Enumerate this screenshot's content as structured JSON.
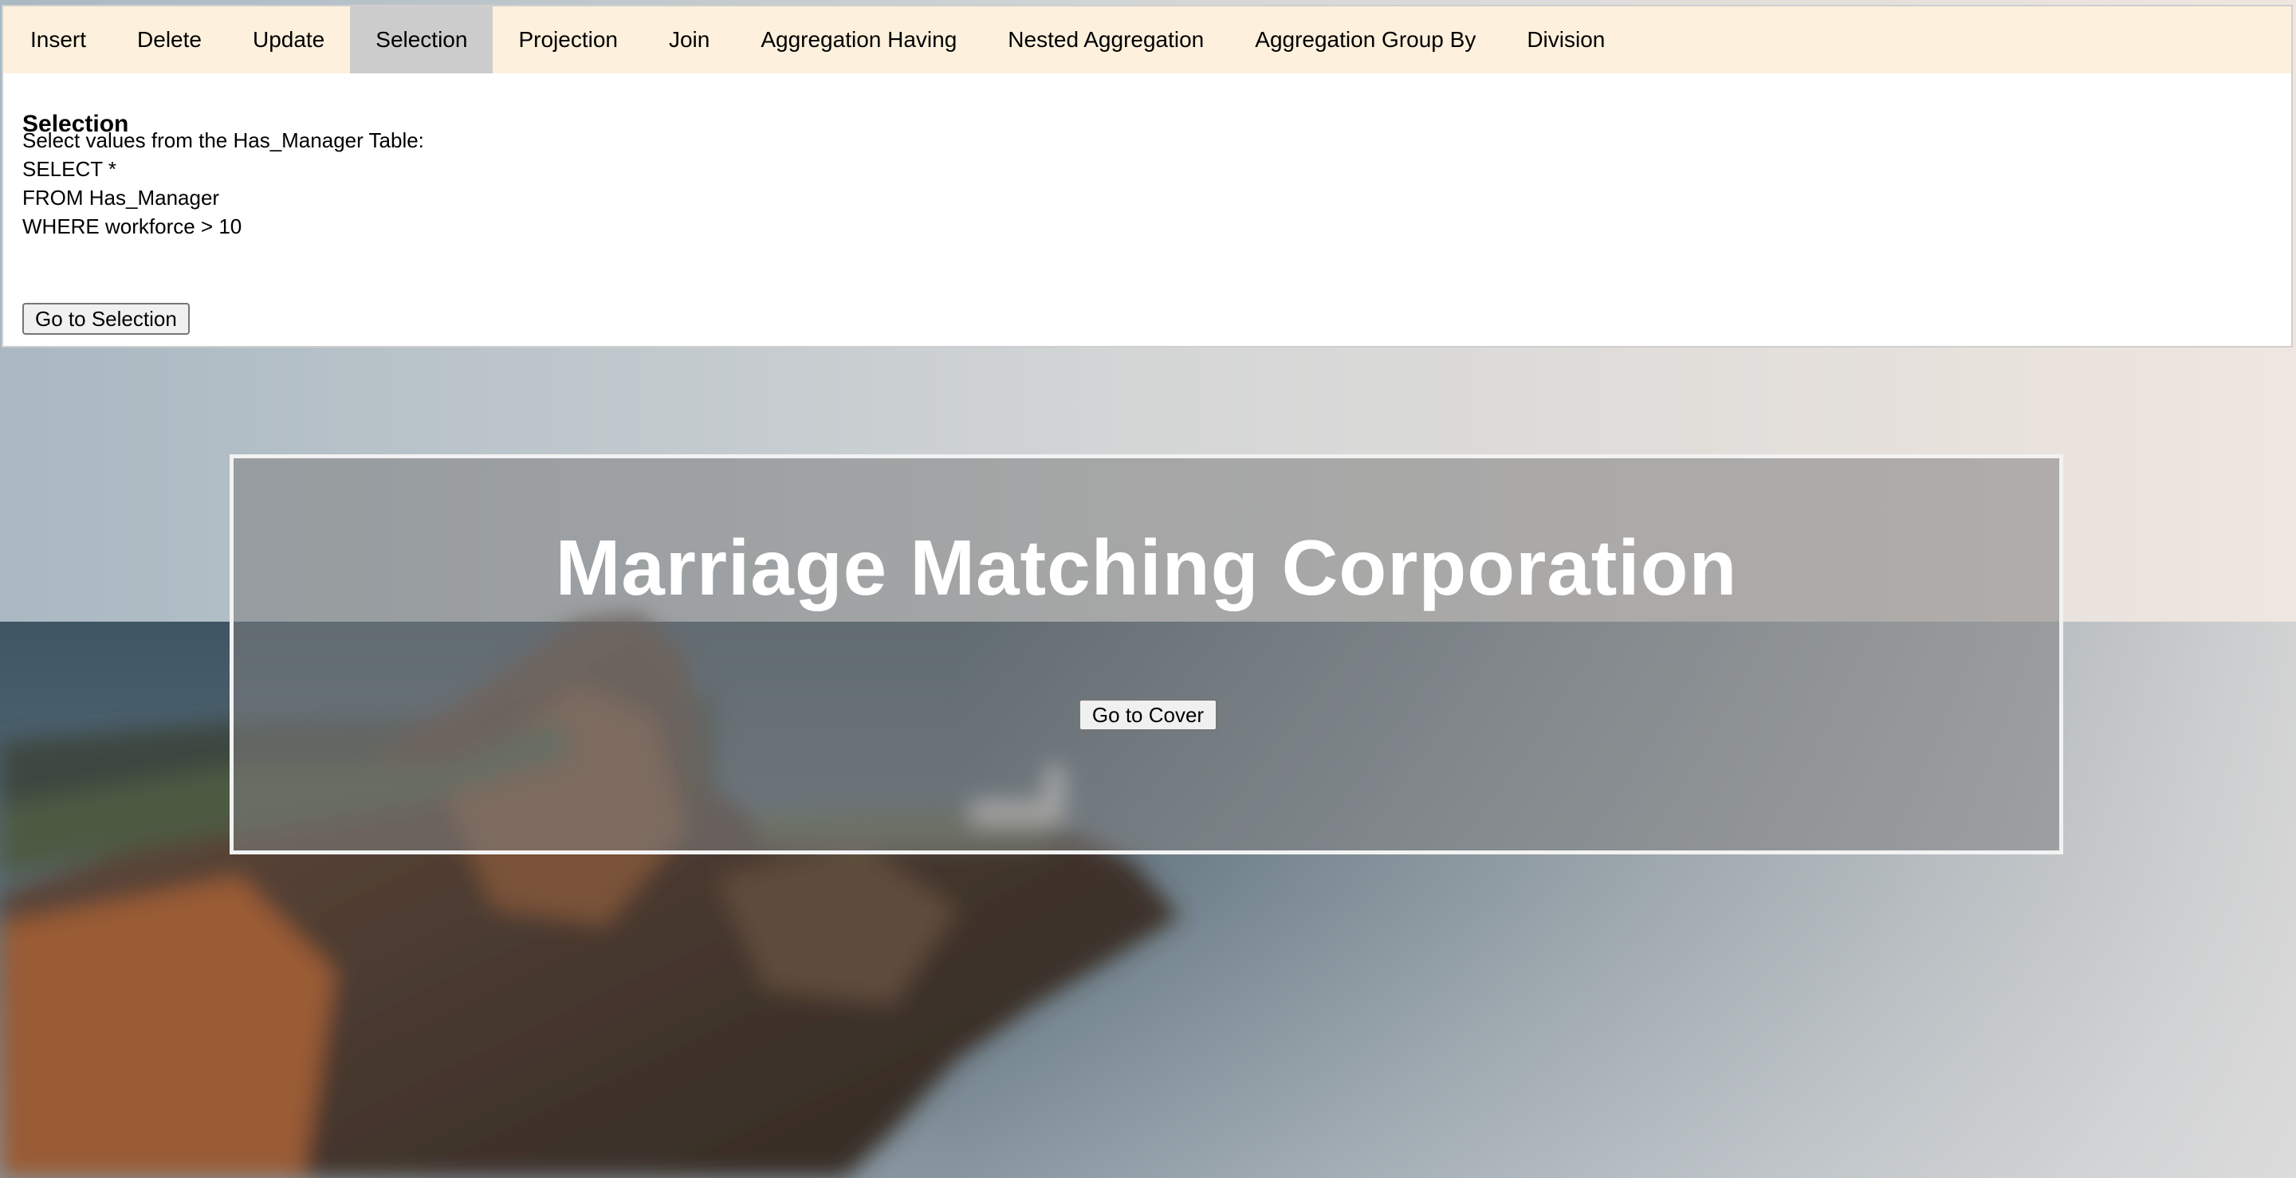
{
  "tabs": [
    {
      "label": "Insert",
      "active": false
    },
    {
      "label": "Delete",
      "active": false
    },
    {
      "label": "Update",
      "active": false
    },
    {
      "label": "Selection",
      "active": true
    },
    {
      "label": "Projection",
      "active": false
    },
    {
      "label": "Join",
      "active": false
    },
    {
      "label": "Aggregation Having",
      "active": false
    },
    {
      "label": "Nested Aggregation",
      "active": false
    },
    {
      "label": "Aggregation Group By",
      "active": false
    },
    {
      "label": "Division",
      "active": false
    }
  ],
  "panel": {
    "title": "Selection",
    "intro": "Select values from the Has_Manager Table:",
    "query_lines": [
      "SELECT *",
      "FROM Has_Manager",
      "WHERE workforce > 10"
    ],
    "button_label": "Go to Selection"
  },
  "hero": {
    "title": "Marriage Matching Corporation",
    "button_label": "Go to Cover"
  },
  "colors": {
    "tabbar_bg": "#fdf0dc",
    "active_tab_bg": "#cccccc",
    "panel_bg": "#ffffff",
    "hero_overlay": "#808080",
    "hero_text": "#ffffff"
  }
}
